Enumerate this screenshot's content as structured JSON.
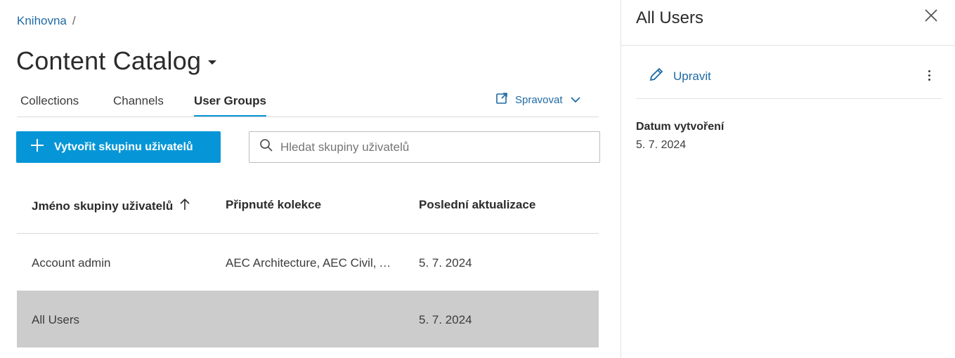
{
  "breadcrumb": {
    "root": "Knihovna",
    "separator": "/"
  },
  "page": {
    "title": "Content Catalog"
  },
  "tabs": [
    {
      "label": "Collections"
    },
    {
      "label": "Channels"
    },
    {
      "label": "User Groups",
      "active": true
    }
  ],
  "manage": {
    "label": "Spravovat"
  },
  "toolbar": {
    "create_label": "Vytvořit skupinu uživatelů",
    "search_placeholder": "Hledat skupiny uživatelů"
  },
  "table": {
    "columns": [
      "Jméno skupiny uživatelů",
      "Připnuté kolekce",
      "Poslední aktualizace"
    ],
    "sort": {
      "column": "Jméno skupiny uživatelů",
      "direction": "ascending"
    },
    "rows": [
      {
        "name": "Account admin",
        "collections": "AEC Architecture, AEC Civil, AEC MEP",
        "updated": "5. 7. 2024",
        "selected": false
      },
      {
        "name": "All Users",
        "collections": "",
        "updated": "5. 7. 2024",
        "selected": true
      }
    ]
  },
  "panel": {
    "title": "All Users",
    "edit_label": "Upravit",
    "created_label": "Datum vytvoření",
    "created_value": "5. 7. 2024"
  },
  "colors": {
    "accent": "#0696d7",
    "link": "#1f6aa5",
    "selected_row": "#cccccc"
  },
  "icons": [
    "external-link-icon",
    "chevron-down-icon",
    "plus-icon",
    "search-icon",
    "sort-arrow-up-icon",
    "close-icon",
    "pencil-icon",
    "more-vertical-icon"
  ]
}
